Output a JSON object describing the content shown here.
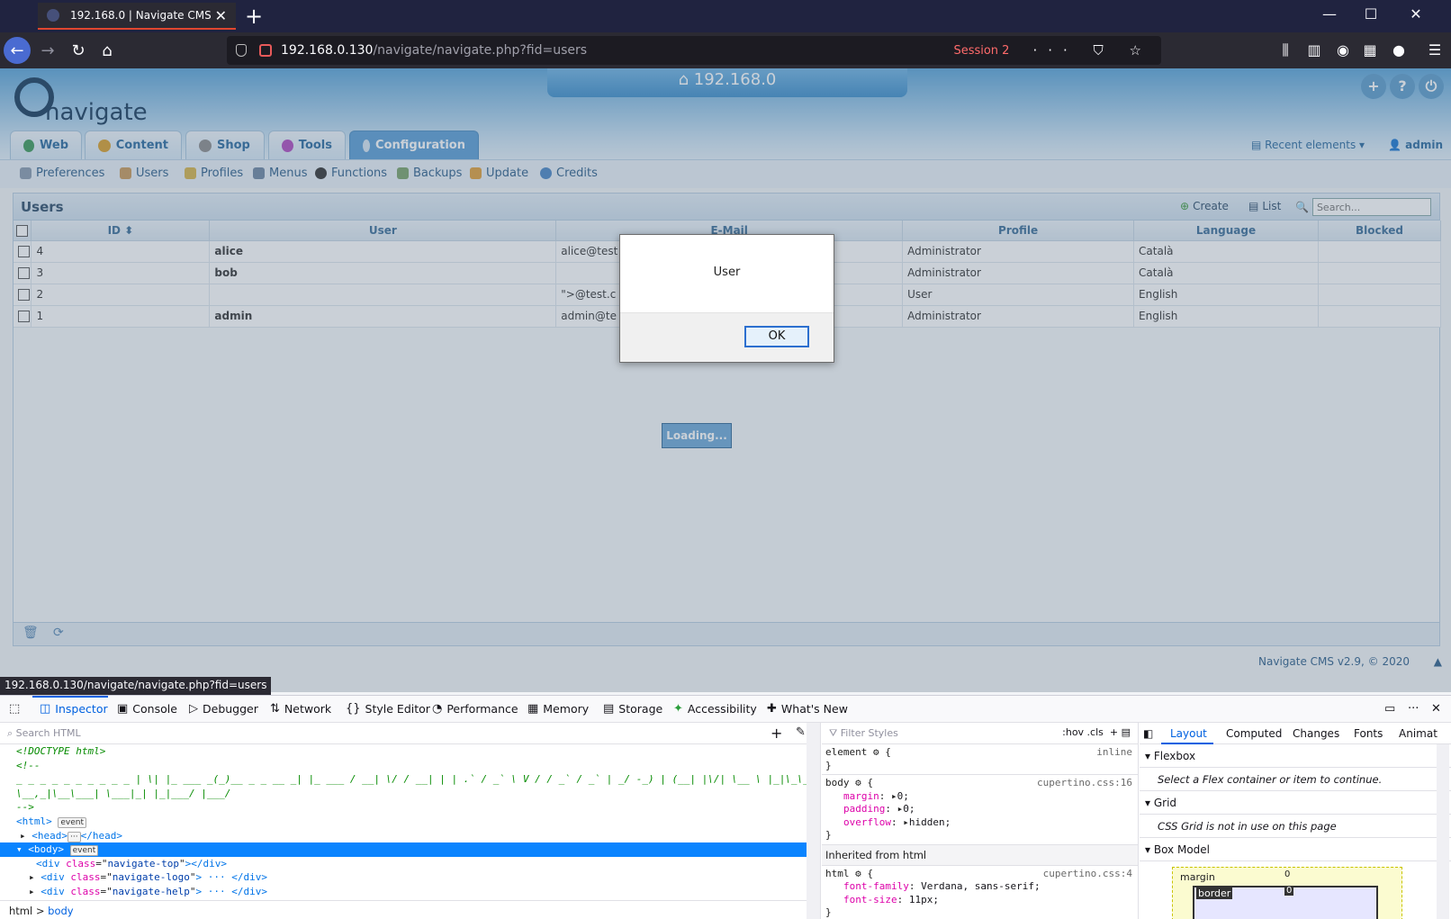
{
  "browser": {
    "tab_title": "192.168.0 | Navigate CMS",
    "url_host": "192.168.0.130",
    "url_path": "/navigate/navigate.php?fid=users",
    "session_label": "Session 2",
    "status_url": "192.168.0.130/navigate/navigate.php?fid=users"
  },
  "cms": {
    "logo_text": "navigate",
    "site_name": "192.168.0",
    "main_tabs": [
      {
        "label": "Web"
      },
      {
        "label": "Content"
      },
      {
        "label": "Shop"
      },
      {
        "label": "Tools"
      },
      {
        "label": "Configuration"
      }
    ],
    "recent_elements": "Recent elements",
    "user": "admin",
    "sub_menu": [
      {
        "label": "Preferences"
      },
      {
        "label": "Users"
      },
      {
        "label": "Profiles"
      },
      {
        "label": "Menus"
      },
      {
        "label": "Functions"
      },
      {
        "label": "Backups"
      },
      {
        "label": "Update"
      },
      {
        "label": "Credits"
      }
    ],
    "panel_title": "Users",
    "create_label": "Create",
    "list_label": "List",
    "search_placeholder": "Search...",
    "columns": [
      "ID",
      "User",
      "E-Mail",
      "Profile",
      "Language",
      "Blocked"
    ],
    "rows": [
      {
        "id": "4",
        "user": "alice",
        "email": "alice@test",
        "profile": "Administrator",
        "language": "Català",
        "blocked": ""
      },
      {
        "id": "3",
        "user": "bob",
        "email": "",
        "profile": "Administrator",
        "language": "Català",
        "blocked": ""
      },
      {
        "id": "2",
        "user": "",
        "email": "\">@test.c",
        "profile": "User",
        "language": "English",
        "blocked": ""
      },
      {
        "id": "1",
        "user": "admin",
        "email": "admin@te",
        "profile": "Administrator",
        "language": "English",
        "blocked": ""
      }
    ],
    "loading": "Loading...",
    "version": "Navigate CMS v2.9, © 2020"
  },
  "dialog": {
    "message": "User",
    "ok_label": "OK"
  },
  "devtools": {
    "tabs": [
      {
        "label": "Inspector"
      },
      {
        "label": "Console"
      },
      {
        "label": "Debugger"
      },
      {
        "label": "Network"
      },
      {
        "label": "Style Editor"
      },
      {
        "label": "Performance"
      },
      {
        "label": "Memory"
      },
      {
        "label": "Storage"
      },
      {
        "label": "Accessibility"
      },
      {
        "label": "What's New"
      }
    ],
    "search_html_placeholder": "Search HTML",
    "html_lines": [
      "<!DOCTYPE html>",
      "<!--",
      "_ _ _ _ _ _ _ _ _ _ | \\| |_ ___ _(_)__ _ _ __ _| |_ ___ / __| \\/ / __| | | .` / _` \\ V / / _` / _` | _/ -_) | (__| |\\/| \\__ \\ |_|\\_\\__,_|\\_/|_\\__,",
      "\\__,_|\\__\\___| \\___|_| |_|___/ |___/",
      "-->"
    ],
    "html_tag": "<html>",
    "head_line": "<head>",
    "head_close": "</head>",
    "body_line": "<body>",
    "event_badge": "event",
    "ellipsis": "···",
    "child_divs": [
      {
        "cls": "navigate-top",
        "tail": "></div>"
      },
      {
        "cls": "navigate-logo",
        "tail": "> ··· </div>"
      },
      {
        "cls": "navigate-help",
        "tail": "> ··· </div>"
      }
    ],
    "breadcrumb": [
      "html",
      "body"
    ],
    "filter_styles_placeholder": "Filter Styles",
    "rule_tools": ":hov  .cls",
    "rules": {
      "element_selector": "element",
      "element_source": "inline",
      "body_selector": "body",
      "body_source": "cupertino.css:16",
      "body_props": [
        {
          "name": "margin",
          "value": "0;"
        },
        {
          "name": "padding",
          "value": "0;"
        },
        {
          "name": "overflow",
          "value": "hidden;"
        }
      ],
      "inherited_label": "Inherited from html",
      "html_selector": "html",
      "html_source": "cupertino.css:4",
      "html_props": [
        {
          "name": "font-family",
          "value": "Verdana, sans-serif;"
        },
        {
          "name": "font-size",
          "value": "11px;"
        }
      ]
    },
    "layout_tabs": [
      {
        "label": "Layout"
      },
      {
        "label": "Computed"
      },
      {
        "label": "Changes"
      },
      {
        "label": "Fonts"
      },
      {
        "label": "Animat"
      }
    ],
    "flexbox_label": "Flexbox",
    "flexbox_note": "Select a Flex container or item to continue.",
    "grid_label": "Grid",
    "grid_note": "CSS Grid is not in use on this page",
    "boxmodel_label": "Box Model",
    "boxmodel_margin": "margin",
    "boxmodel_border": "border",
    "boxmodel_zero": "0"
  }
}
